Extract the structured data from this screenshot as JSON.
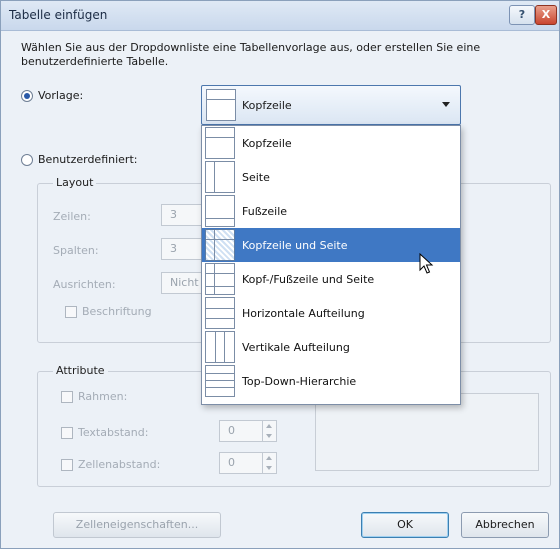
{
  "window": {
    "title": "Tabelle einfügen",
    "help_button": "?",
    "close_button": "X"
  },
  "intro_text": "Wählen Sie aus der Dropdownliste eine Tabellenvorlage aus, oder erstellen Sie eine benutzerdefinierte Tabelle.",
  "vorlage": {
    "label": "Vorlage:",
    "selected": true,
    "combo_value": "Kopfzeile"
  },
  "benutzerdefiniert": {
    "label": "Benutzerdefiniert:",
    "selected": false
  },
  "layout": {
    "title": "Layout",
    "zeilen_label": "Zeilen:",
    "zeilen_value": "3",
    "spalten_label": "Spalten:",
    "spalten_value": "3",
    "ausrichten_label": "Ausrichten:",
    "ausrichten_value": "Nicht",
    "beschriftung_label": "Beschriftung"
  },
  "attribute": {
    "title": "Attribute",
    "rahmen_label": "Rahmen:",
    "textabstand_label": "Textabstand:",
    "textabstand_value": "0",
    "zellenabstand_label": "Zellenabstand:",
    "zellenabstand_value": "0"
  },
  "dropdown": {
    "items": [
      {
        "label": "Kopfzeile",
        "highlighted": false
      },
      {
        "label": "Seite",
        "highlighted": false
      },
      {
        "label": "Fußzeile",
        "highlighted": false
      },
      {
        "label": "Kopfzeile und Seite",
        "highlighted": true
      },
      {
        "label": "Kopf-/Fußzeile und Seite",
        "highlighted": false
      },
      {
        "label": "Horizontale Aufteilung",
        "highlighted": false
      },
      {
        "label": "Vertikale Aufteilung",
        "highlighted": false
      },
      {
        "label": "Top-Down-Hierarchie",
        "highlighted": false
      }
    ]
  },
  "buttons": {
    "cell_props": "Zelleneigenschaften...",
    "ok": "OK",
    "cancel": "Abbrechen"
  },
  "colors": {
    "highlight": "#3f78c4",
    "dialog_bg": "#ecf1f7",
    "close_button": "#c9452f"
  }
}
